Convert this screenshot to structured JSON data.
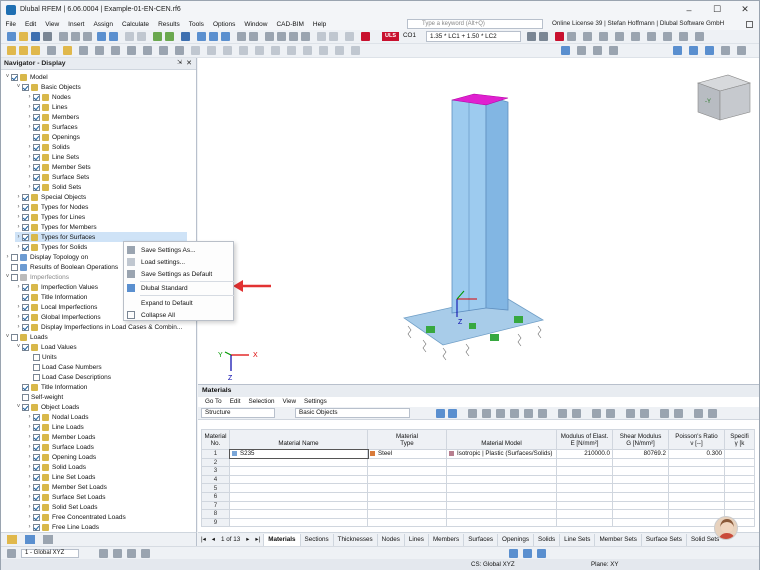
{
  "window": {
    "title": "Dlubal RFEM | 6.06.0004 | Example-01-EN-CEN.rf6"
  },
  "menu": [
    "File",
    "Edit",
    "View",
    "Insert",
    "Assign",
    "Calculate",
    "Results",
    "Tools",
    "Options",
    "Window",
    "CAD-BIM",
    "Help"
  ],
  "search": {
    "placeholder": "Type a keyword (Alt+Q)"
  },
  "license": "Online License 39 | Stefan Hoffmann | Dlubal Software GmbH",
  "toolbar": {
    "uls_badge": "ULS",
    "load_case": "CO1",
    "combination": "1.35 * LC1 + 1.50 * LC2"
  },
  "navigator": {
    "title": "Navigator - Display",
    "items": [
      {
        "label": "Model",
        "level": 0,
        "arrow": "˅",
        "check": true,
        "icon": "#d8b84a"
      },
      {
        "label": "Basic Objects",
        "level": 1,
        "arrow": "˅",
        "check": true,
        "icon": "#d8b84a"
      },
      {
        "label": "Nodes",
        "level": 2,
        "arrow": "›",
        "check": true,
        "icon": "#d8b84a"
      },
      {
        "label": "Lines",
        "level": 2,
        "arrow": "›",
        "check": true,
        "icon": "#d8b84a"
      },
      {
        "label": "Members",
        "level": 2,
        "arrow": "›",
        "check": true,
        "icon": "#d8b84a"
      },
      {
        "label": "Surfaces",
        "level": 2,
        "arrow": "›",
        "check": true,
        "icon": "#d8b84a"
      },
      {
        "label": "Openings",
        "level": 2,
        "arrow": "",
        "check": true,
        "icon": "#d8b84a"
      },
      {
        "label": "Solids",
        "level": 2,
        "arrow": "›",
        "check": true,
        "icon": "#d8b84a"
      },
      {
        "label": "Line Sets",
        "level": 2,
        "arrow": "›",
        "check": true,
        "icon": "#d8b84a"
      },
      {
        "label": "Member Sets",
        "level": 2,
        "arrow": "›",
        "check": true,
        "icon": "#d8b84a"
      },
      {
        "label": "Surface Sets",
        "level": 2,
        "arrow": "›",
        "check": true,
        "icon": "#d8b84a"
      },
      {
        "label": "Solid Sets",
        "level": 2,
        "arrow": "›",
        "check": true,
        "icon": "#d8b84a"
      },
      {
        "label": "Special Objects",
        "level": 1,
        "arrow": "›",
        "check": true,
        "icon": "#d8b84a"
      },
      {
        "label": "Types for Nodes",
        "level": 1,
        "arrow": "›",
        "check": true,
        "icon": "#d8b84a"
      },
      {
        "label": "Types for Lines",
        "level": 1,
        "arrow": "›",
        "check": true,
        "icon": "#d8b84a"
      },
      {
        "label": "Types for Members",
        "level": 1,
        "arrow": "›",
        "check": true,
        "icon": "#d8b84a"
      },
      {
        "label": "Types for Surfaces",
        "level": 1,
        "arrow": "›",
        "check": true,
        "icon": "#d8b84a",
        "selected": true
      },
      {
        "label": "Types for Solids",
        "level": 1,
        "arrow": "›",
        "check": true,
        "icon": "#d8b84a"
      },
      {
        "label": "Display Topology on",
        "level": 0,
        "arrow": "›",
        "check": false,
        "icon": "#6c9bd2"
      },
      {
        "label": "Results of Boolean Operations",
        "level": 0,
        "arrow": "",
        "check": false,
        "icon": "#6c9bd2"
      },
      {
        "label": "Imperfections",
        "level": 0,
        "arrow": "˅",
        "check": false,
        "icon": "#bbbbbb",
        "grey": true
      },
      {
        "label": "Imperfection Values",
        "level": 1,
        "arrow": "›",
        "check": true,
        "icon": "#d8b84a"
      },
      {
        "label": "Title Information",
        "level": 1,
        "arrow": "",
        "check": true,
        "icon": "#d8b84a"
      },
      {
        "label": "Local Imperfections",
        "level": 1,
        "arrow": "›",
        "check": true,
        "icon": "#d8b84a"
      },
      {
        "label": "Global Imperfections",
        "level": 1,
        "arrow": "›",
        "check": true,
        "icon": "#d8b84a"
      },
      {
        "label": "Display Imperfections in Load Cases & Combin...",
        "level": 1,
        "arrow": "›",
        "check": true,
        "icon": "#d8b84a"
      },
      {
        "label": "Loads",
        "level": 0,
        "arrow": "˅",
        "check": false,
        "icon": "#d8b84a"
      },
      {
        "label": "Load Values",
        "level": 1,
        "arrow": "˅",
        "check": true,
        "icon": "#d8b84a"
      },
      {
        "label": "Units",
        "level": 2,
        "arrow": "",
        "check": false,
        "icon": ""
      },
      {
        "label": "Load Case Numbers",
        "level": 2,
        "arrow": "",
        "check": false,
        "icon": ""
      },
      {
        "label": "Load Case Descriptions",
        "level": 2,
        "arrow": "",
        "check": false,
        "icon": ""
      },
      {
        "label": "Title Information",
        "level": 1,
        "arrow": "",
        "check": true,
        "icon": "#d8b84a"
      },
      {
        "label": "Self-weight",
        "level": 1,
        "arrow": "",
        "check": false,
        "icon": ""
      },
      {
        "label": "Object Loads",
        "level": 1,
        "arrow": "˅",
        "check": true,
        "icon": "#d8b84a"
      },
      {
        "label": "Nodal Loads",
        "level": 2,
        "arrow": "›",
        "check": true,
        "icon": "#d8b84a"
      },
      {
        "label": "Line Loads",
        "level": 2,
        "arrow": "›",
        "check": true,
        "icon": "#d8b84a"
      },
      {
        "label": "Member Loads",
        "level": 2,
        "arrow": "›",
        "check": true,
        "icon": "#d8b84a"
      },
      {
        "label": "Surface Loads",
        "level": 2,
        "arrow": "›",
        "check": true,
        "icon": "#d8b84a"
      },
      {
        "label": "Opening Loads",
        "level": 2,
        "arrow": "›",
        "check": true,
        "icon": "#d8b84a"
      },
      {
        "label": "Solid Loads",
        "level": 2,
        "arrow": "›",
        "check": true,
        "icon": "#d8b84a"
      },
      {
        "label": "Line Set Loads",
        "level": 2,
        "arrow": "›",
        "check": true,
        "icon": "#d8b84a"
      },
      {
        "label": "Member Set Loads",
        "level": 2,
        "arrow": "›",
        "check": true,
        "icon": "#d8b84a"
      },
      {
        "label": "Surface Set Loads",
        "level": 2,
        "arrow": "›",
        "check": true,
        "icon": "#d8b84a"
      },
      {
        "label": "Solid Set Loads",
        "level": 2,
        "arrow": "›",
        "check": true,
        "icon": "#d8b84a"
      },
      {
        "label": "Free Concentrated Loads",
        "level": 2,
        "arrow": "›",
        "check": true,
        "icon": "#d8b84a"
      },
      {
        "label": "Free Line Loads",
        "level": 2,
        "arrow": "›",
        "check": true,
        "icon": "#d8b84a"
      }
    ]
  },
  "context_menu": {
    "items": [
      "Save Settings As...",
      "Load settings...",
      "Save Settings as Default",
      "Dlubal Standard",
      "Expand to Default",
      "Collapse All"
    ]
  },
  "viewport": {
    "axis_x": "X",
    "axis_y": "Y",
    "axis_z": "Z",
    "cube_face": "-Y"
  },
  "materials_panel": {
    "title": "Materials",
    "menu": [
      "Go To",
      "Edit",
      "Selection",
      "View",
      "Settings"
    ],
    "structure_combo": "Structure",
    "objects_combo": "Basic Objects",
    "columns": [
      [
        "Material",
        "No."
      ],
      [
        "",
        "Material Name"
      ],
      [
        "Material",
        "Type"
      ],
      [
        "",
        "Material Model"
      ],
      [
        "Modulus of Elast.",
        "E [N/mm²]"
      ],
      [
        "Shear Modulus",
        "G [N/mm²]"
      ],
      [
        "Poisson's Ratio",
        "ν [--]"
      ],
      [
        "Specifi",
        "γ [k"
      ]
    ],
    "rows": [
      {
        "no": "1",
        "name": "S235",
        "type": "Steel",
        "model": "Isotropic | Plastic (Surfaces/Solids)",
        "e": "210000.0",
        "g": "80769.2",
        "nu": "0.300",
        "gamma": ""
      },
      {
        "no": "2"
      },
      {
        "no": "3"
      },
      {
        "no": "4"
      },
      {
        "no": "5"
      },
      {
        "no": "6"
      },
      {
        "no": "7"
      },
      {
        "no": "8"
      },
      {
        "no": "9"
      }
    ],
    "colors": {
      "steel": "#d97b3a",
      "model": "#b87f8f",
      "name": "#7aa6d8"
    }
  },
  "tabs": {
    "pager": "1 of 13",
    "items": [
      "Materials",
      "Sections",
      "Thicknesses",
      "Nodes",
      "Lines",
      "Members",
      "Surfaces",
      "Openings",
      "Solids",
      "Line Sets",
      "Member Sets",
      "Surface Sets",
      "Solid Sets"
    ]
  },
  "bottom_toolbar": {
    "coord_system": "1 - Global XYZ"
  },
  "status": {
    "cs": "CS: Global XYZ",
    "plane": "Plane: XY"
  }
}
